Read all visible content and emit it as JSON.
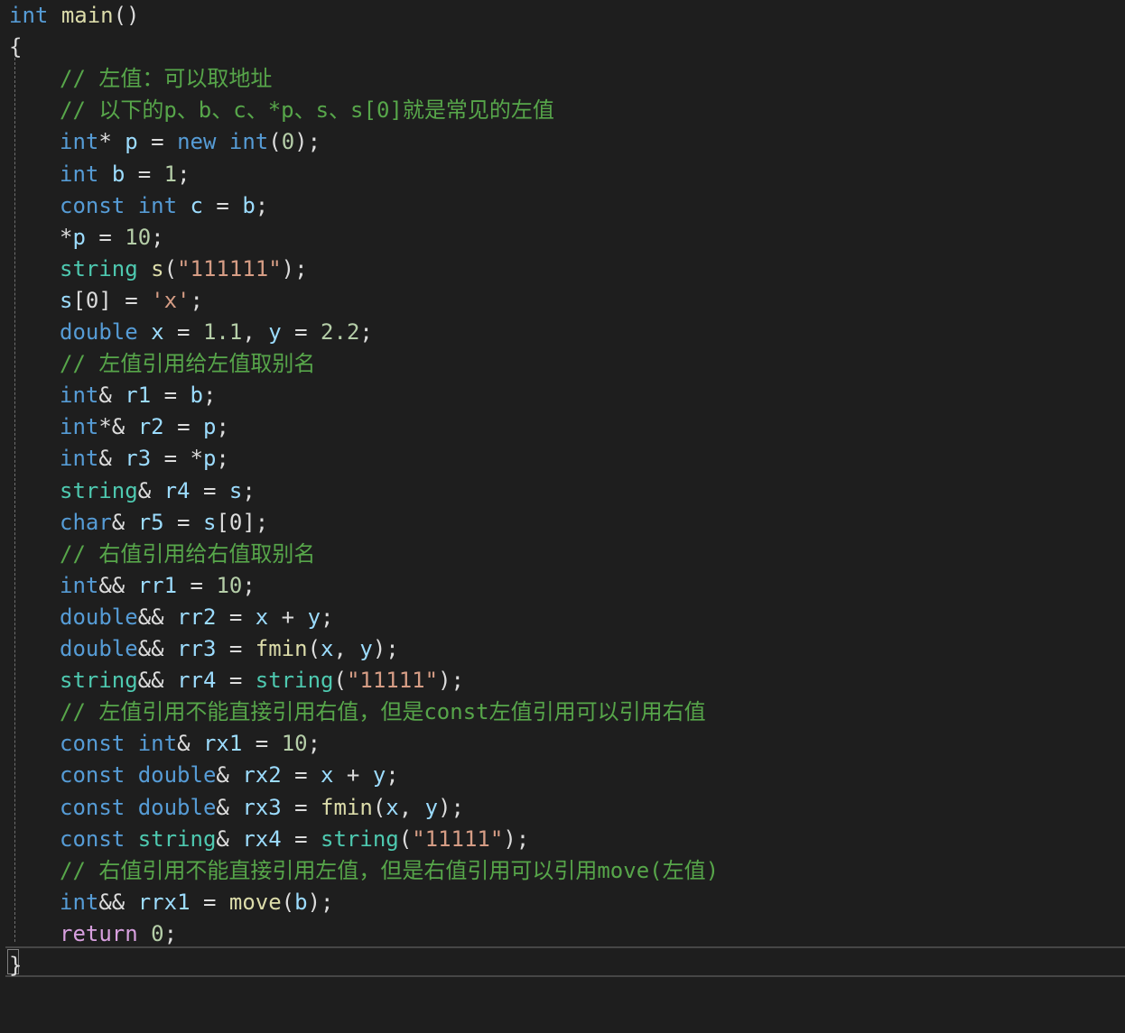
{
  "editor": {
    "lines": [
      {
        "indent": 0,
        "tokens": [
          {
            "t": "int",
            "c": "kw"
          },
          {
            "t": " ",
            "c": "pl"
          },
          {
            "t": "main",
            "c": "fn"
          },
          {
            "t": "()",
            "c": "pl"
          }
        ]
      },
      {
        "indent": 0,
        "tokens": [
          {
            "t": "{",
            "c": "pl"
          }
        ]
      },
      {
        "indent": 1,
        "tokens": [
          {
            "t": "// 左值：可以取地址",
            "c": "cm"
          }
        ]
      },
      {
        "indent": 1,
        "tokens": [
          {
            "t": "// 以下的p、b、c、*p、s、s[0]就是常见的左值",
            "c": "cm"
          }
        ]
      },
      {
        "indent": 1,
        "tokens": [
          {
            "t": "int",
            "c": "kw"
          },
          {
            "t": "* ",
            "c": "pl"
          },
          {
            "t": "p",
            "c": "id"
          },
          {
            "t": " = ",
            "c": "pl"
          },
          {
            "t": "new",
            "c": "kw"
          },
          {
            "t": " ",
            "c": "pl"
          },
          {
            "t": "int",
            "c": "kw"
          },
          {
            "t": "(",
            "c": "pl"
          },
          {
            "t": "0",
            "c": "num"
          },
          {
            "t": ");",
            "c": "pl"
          }
        ]
      },
      {
        "indent": 1,
        "tokens": [
          {
            "t": "int",
            "c": "kw"
          },
          {
            "t": " ",
            "c": "pl"
          },
          {
            "t": "b",
            "c": "id"
          },
          {
            "t": " = ",
            "c": "pl"
          },
          {
            "t": "1",
            "c": "num"
          },
          {
            "t": ";",
            "c": "pl"
          }
        ]
      },
      {
        "indent": 1,
        "tokens": [
          {
            "t": "const",
            "c": "kw"
          },
          {
            "t": " ",
            "c": "pl"
          },
          {
            "t": "int",
            "c": "kw"
          },
          {
            "t": " ",
            "c": "pl"
          },
          {
            "t": "c",
            "c": "id"
          },
          {
            "t": " = ",
            "c": "pl"
          },
          {
            "t": "b",
            "c": "id"
          },
          {
            "t": ";",
            "c": "pl"
          }
        ]
      },
      {
        "indent": 1,
        "tokens": [
          {
            "t": "*",
            "c": "pl"
          },
          {
            "t": "p",
            "c": "id"
          },
          {
            "t": " = ",
            "c": "pl"
          },
          {
            "t": "10",
            "c": "num"
          },
          {
            "t": ";",
            "c": "pl"
          }
        ]
      },
      {
        "indent": 1,
        "tokens": [
          {
            "t": "string",
            "c": "ty"
          },
          {
            "t": " ",
            "c": "pl"
          },
          {
            "t": "s",
            "c": "fn"
          },
          {
            "t": "(",
            "c": "pl"
          },
          {
            "t": "\"111111\"",
            "c": "str"
          },
          {
            "t": ");",
            "c": "pl"
          }
        ]
      },
      {
        "indent": 1,
        "tokens": [
          {
            "t": "s",
            "c": "id"
          },
          {
            "t": "[0] = ",
            "c": "pl"
          },
          {
            "t": "'x'",
            "c": "str"
          },
          {
            "t": ";",
            "c": "pl"
          }
        ]
      },
      {
        "indent": 1,
        "tokens": [
          {
            "t": "double",
            "c": "kw"
          },
          {
            "t": " ",
            "c": "pl"
          },
          {
            "t": "x",
            "c": "id"
          },
          {
            "t": " = ",
            "c": "pl"
          },
          {
            "t": "1.1",
            "c": "num"
          },
          {
            "t": ", ",
            "c": "pl"
          },
          {
            "t": "y",
            "c": "id"
          },
          {
            "t": " = ",
            "c": "pl"
          },
          {
            "t": "2.2",
            "c": "num"
          },
          {
            "t": ";",
            "c": "pl"
          }
        ]
      },
      {
        "indent": 1,
        "tokens": [
          {
            "t": "// 左值引用给左值取别名",
            "c": "cm"
          }
        ]
      },
      {
        "indent": 1,
        "tokens": [
          {
            "t": "int",
            "c": "kw"
          },
          {
            "t": "& ",
            "c": "pl"
          },
          {
            "t": "r1",
            "c": "id"
          },
          {
            "t": " = ",
            "c": "pl"
          },
          {
            "t": "b",
            "c": "id"
          },
          {
            "t": ";",
            "c": "pl"
          }
        ]
      },
      {
        "indent": 1,
        "tokens": [
          {
            "t": "int",
            "c": "kw"
          },
          {
            "t": "*& ",
            "c": "pl"
          },
          {
            "t": "r2",
            "c": "id"
          },
          {
            "t": " = ",
            "c": "pl"
          },
          {
            "t": "p",
            "c": "id"
          },
          {
            "t": ";",
            "c": "pl"
          }
        ]
      },
      {
        "indent": 1,
        "tokens": [
          {
            "t": "int",
            "c": "kw"
          },
          {
            "t": "& ",
            "c": "pl"
          },
          {
            "t": "r3",
            "c": "id"
          },
          {
            "t": " = *",
            "c": "pl"
          },
          {
            "t": "p",
            "c": "id"
          },
          {
            "t": ";",
            "c": "pl"
          }
        ]
      },
      {
        "indent": 1,
        "tokens": [
          {
            "t": "string",
            "c": "ty"
          },
          {
            "t": "& ",
            "c": "pl"
          },
          {
            "t": "r4",
            "c": "id"
          },
          {
            "t": " = ",
            "c": "pl"
          },
          {
            "t": "s",
            "c": "id"
          },
          {
            "t": ";",
            "c": "pl"
          }
        ]
      },
      {
        "indent": 1,
        "tokens": [
          {
            "t": "char",
            "c": "kw"
          },
          {
            "t": "& ",
            "c": "pl"
          },
          {
            "t": "r5",
            "c": "id"
          },
          {
            "t": " = ",
            "c": "pl"
          },
          {
            "t": "s",
            "c": "id"
          },
          {
            "t": "[0];",
            "c": "pl"
          }
        ]
      },
      {
        "indent": 1,
        "tokens": [
          {
            "t": "// 右值引用给右值取别名",
            "c": "cm"
          }
        ]
      },
      {
        "indent": 1,
        "tokens": [
          {
            "t": "int",
            "c": "kw"
          },
          {
            "t": "&& ",
            "c": "pl"
          },
          {
            "t": "rr1",
            "c": "id"
          },
          {
            "t": " = ",
            "c": "pl"
          },
          {
            "t": "10",
            "c": "num"
          },
          {
            "t": ";",
            "c": "pl"
          }
        ]
      },
      {
        "indent": 1,
        "tokens": [
          {
            "t": "double",
            "c": "kw"
          },
          {
            "t": "&& ",
            "c": "pl"
          },
          {
            "t": "rr2",
            "c": "id"
          },
          {
            "t": " = ",
            "c": "pl"
          },
          {
            "t": "x",
            "c": "id"
          },
          {
            "t": " + ",
            "c": "pl"
          },
          {
            "t": "y",
            "c": "id"
          },
          {
            "t": ";",
            "c": "pl"
          }
        ]
      },
      {
        "indent": 1,
        "tokens": [
          {
            "t": "double",
            "c": "kw"
          },
          {
            "t": "&& ",
            "c": "pl"
          },
          {
            "t": "rr3",
            "c": "id"
          },
          {
            "t": " = ",
            "c": "pl"
          },
          {
            "t": "fmin",
            "c": "fn"
          },
          {
            "t": "(",
            "c": "pl"
          },
          {
            "t": "x",
            "c": "id"
          },
          {
            "t": ", ",
            "c": "pl"
          },
          {
            "t": "y",
            "c": "id"
          },
          {
            "t": ");",
            "c": "pl"
          }
        ]
      },
      {
        "indent": 1,
        "tokens": [
          {
            "t": "string",
            "c": "ty"
          },
          {
            "t": "&& ",
            "c": "pl"
          },
          {
            "t": "rr4",
            "c": "id"
          },
          {
            "t": " = ",
            "c": "pl"
          },
          {
            "t": "string",
            "c": "ty"
          },
          {
            "t": "(",
            "c": "pl"
          },
          {
            "t": "\"11111\"",
            "c": "str"
          },
          {
            "t": ");",
            "c": "pl"
          }
        ]
      },
      {
        "indent": 1,
        "tokens": [
          {
            "t": "// 左值引用不能直接引用右值，但是const左值引用可以引用右值",
            "c": "cm"
          }
        ]
      },
      {
        "indent": 1,
        "tokens": [
          {
            "t": "const",
            "c": "kw"
          },
          {
            "t": " ",
            "c": "pl"
          },
          {
            "t": "int",
            "c": "kw"
          },
          {
            "t": "& ",
            "c": "pl"
          },
          {
            "t": "rx1",
            "c": "id"
          },
          {
            "t": " = ",
            "c": "pl"
          },
          {
            "t": "10",
            "c": "num"
          },
          {
            "t": ";",
            "c": "pl"
          }
        ]
      },
      {
        "indent": 1,
        "tokens": [
          {
            "t": "const",
            "c": "kw"
          },
          {
            "t": " ",
            "c": "pl"
          },
          {
            "t": "double",
            "c": "kw"
          },
          {
            "t": "& ",
            "c": "pl"
          },
          {
            "t": "rx2",
            "c": "id"
          },
          {
            "t": " = ",
            "c": "pl"
          },
          {
            "t": "x",
            "c": "id"
          },
          {
            "t": " + ",
            "c": "pl"
          },
          {
            "t": "y",
            "c": "id"
          },
          {
            "t": ";",
            "c": "pl"
          }
        ]
      },
      {
        "indent": 1,
        "tokens": [
          {
            "t": "const",
            "c": "kw"
          },
          {
            "t": " ",
            "c": "pl"
          },
          {
            "t": "double",
            "c": "kw"
          },
          {
            "t": "& ",
            "c": "pl"
          },
          {
            "t": "rx3",
            "c": "id"
          },
          {
            "t": " = ",
            "c": "pl"
          },
          {
            "t": "fmin",
            "c": "fn"
          },
          {
            "t": "(",
            "c": "pl"
          },
          {
            "t": "x",
            "c": "id"
          },
          {
            "t": ", ",
            "c": "pl"
          },
          {
            "t": "y",
            "c": "id"
          },
          {
            "t": ");",
            "c": "pl"
          }
        ]
      },
      {
        "indent": 1,
        "tokens": [
          {
            "t": "const",
            "c": "kw"
          },
          {
            "t": " ",
            "c": "pl"
          },
          {
            "t": "string",
            "c": "ty"
          },
          {
            "t": "& ",
            "c": "pl"
          },
          {
            "t": "rx4",
            "c": "id"
          },
          {
            "t": " = ",
            "c": "pl"
          },
          {
            "t": "string",
            "c": "ty"
          },
          {
            "t": "(",
            "c": "pl"
          },
          {
            "t": "\"11111\"",
            "c": "str"
          },
          {
            "t": ");",
            "c": "pl"
          }
        ]
      },
      {
        "indent": 1,
        "tokens": [
          {
            "t": "// 右值引用不能直接引用左值，但是右值引用可以引用move(左值)",
            "c": "cm"
          }
        ]
      },
      {
        "indent": 1,
        "tokens": [
          {
            "t": "int",
            "c": "kw"
          },
          {
            "t": "&& ",
            "c": "pl"
          },
          {
            "t": "rrx1",
            "c": "id"
          },
          {
            "t": " = ",
            "c": "pl"
          },
          {
            "t": "move",
            "c": "fn"
          },
          {
            "t": "(",
            "c": "pl"
          },
          {
            "t": "b",
            "c": "id"
          },
          {
            "t": ");",
            "c": "pl"
          }
        ]
      },
      {
        "indent": 1,
        "tokens": [
          {
            "t": "return",
            "c": "ret"
          },
          {
            "t": " ",
            "c": "pl"
          },
          {
            "t": "0",
            "c": "num"
          },
          {
            "t": ";",
            "c": "pl"
          }
        ]
      },
      {
        "indent": 0,
        "tokens": [
          {
            "t": "}",
            "c": "pl"
          }
        ]
      }
    ]
  }
}
